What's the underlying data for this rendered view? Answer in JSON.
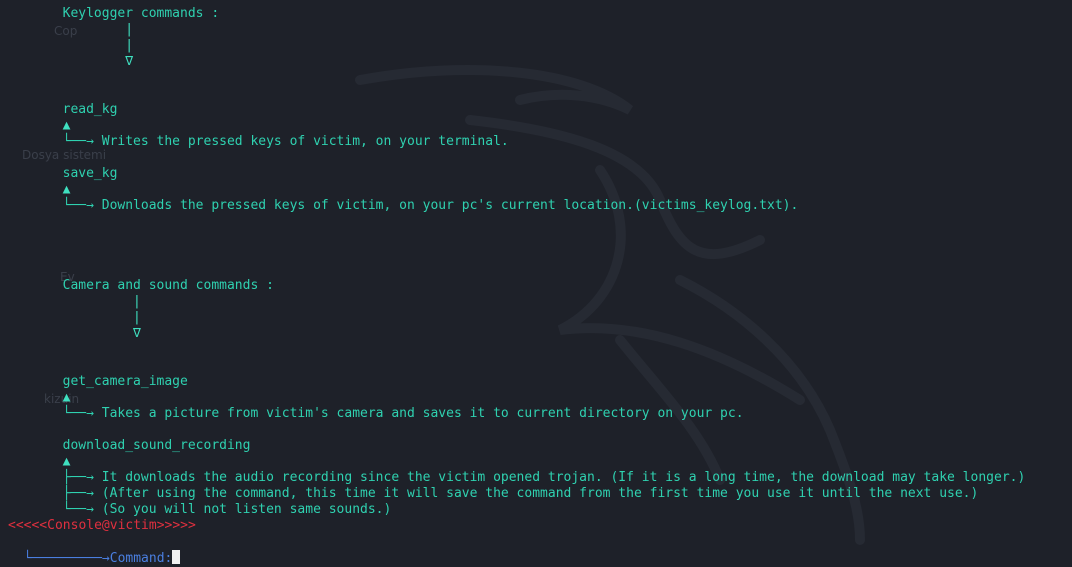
{
  "terminal": {
    "lines": [
      {
        "text": "        Keylogger commands :"
      },
      {
        "text": "                |"
      },
      {
        "text": "                |"
      },
      {
        "text": "                ∇"
      },
      {
        "text": ""
      },
      {
        "text": ""
      },
      {
        "text": "        read_kg"
      },
      {
        "text": "        ▲"
      },
      {
        "text": "        └──→ Writes the pressed keys of victim, on your terminal."
      },
      {
        "text": ""
      },
      {
        "text": "        save_kg"
      },
      {
        "text": "        ▲"
      },
      {
        "text": "        └──→ Downloads the pressed keys of victim, on your pc's current location.(victims_keylog.txt)."
      },
      {
        "text": ""
      },
      {
        "text": ""
      },
      {
        "text": ""
      },
      {
        "text": ""
      },
      {
        "text": "        Camera and sound commands :"
      },
      {
        "text": "                 |"
      },
      {
        "text": "                 |"
      },
      {
        "text": "                 ∇"
      },
      {
        "text": ""
      },
      {
        "text": ""
      },
      {
        "text": "        get_camera_image"
      },
      {
        "text": "        ▲"
      },
      {
        "text": "        └──→ Takes a picture from victim's camera and saves it to current directory on your pc."
      },
      {
        "text": ""
      },
      {
        "text": "        download_sound_recording"
      },
      {
        "text": ""
      },
      {
        "text": "        ▲"
      },
      {
        "text": "        ├──→ It downloads the audio recording since the victim opened trojan. (If it is a long time, the download may take longer.)"
      },
      {
        "text": "        ├──→ (After using the command, this time it will save the command from the first time you use it until the next use.)"
      },
      {
        "text": "        └──→ (So you will not listen same sounds.)"
      }
    ],
    "prompt_line1": "<<<<<Console@victim>>>>>",
    "prompt_line2_prefix": "└─────────→",
    "prompt_label": "Command:",
    "input_value": ""
  },
  "desktop_icons": [
    "Cop",
    "Dosya sistemi",
    "Ev",
    "kizuin"
  ],
  "colors": {
    "background": "#1e2129",
    "text": "#2fd1b0",
    "prompt_red": "#e0303f",
    "prompt_blue": "#4a7fe0"
  }
}
